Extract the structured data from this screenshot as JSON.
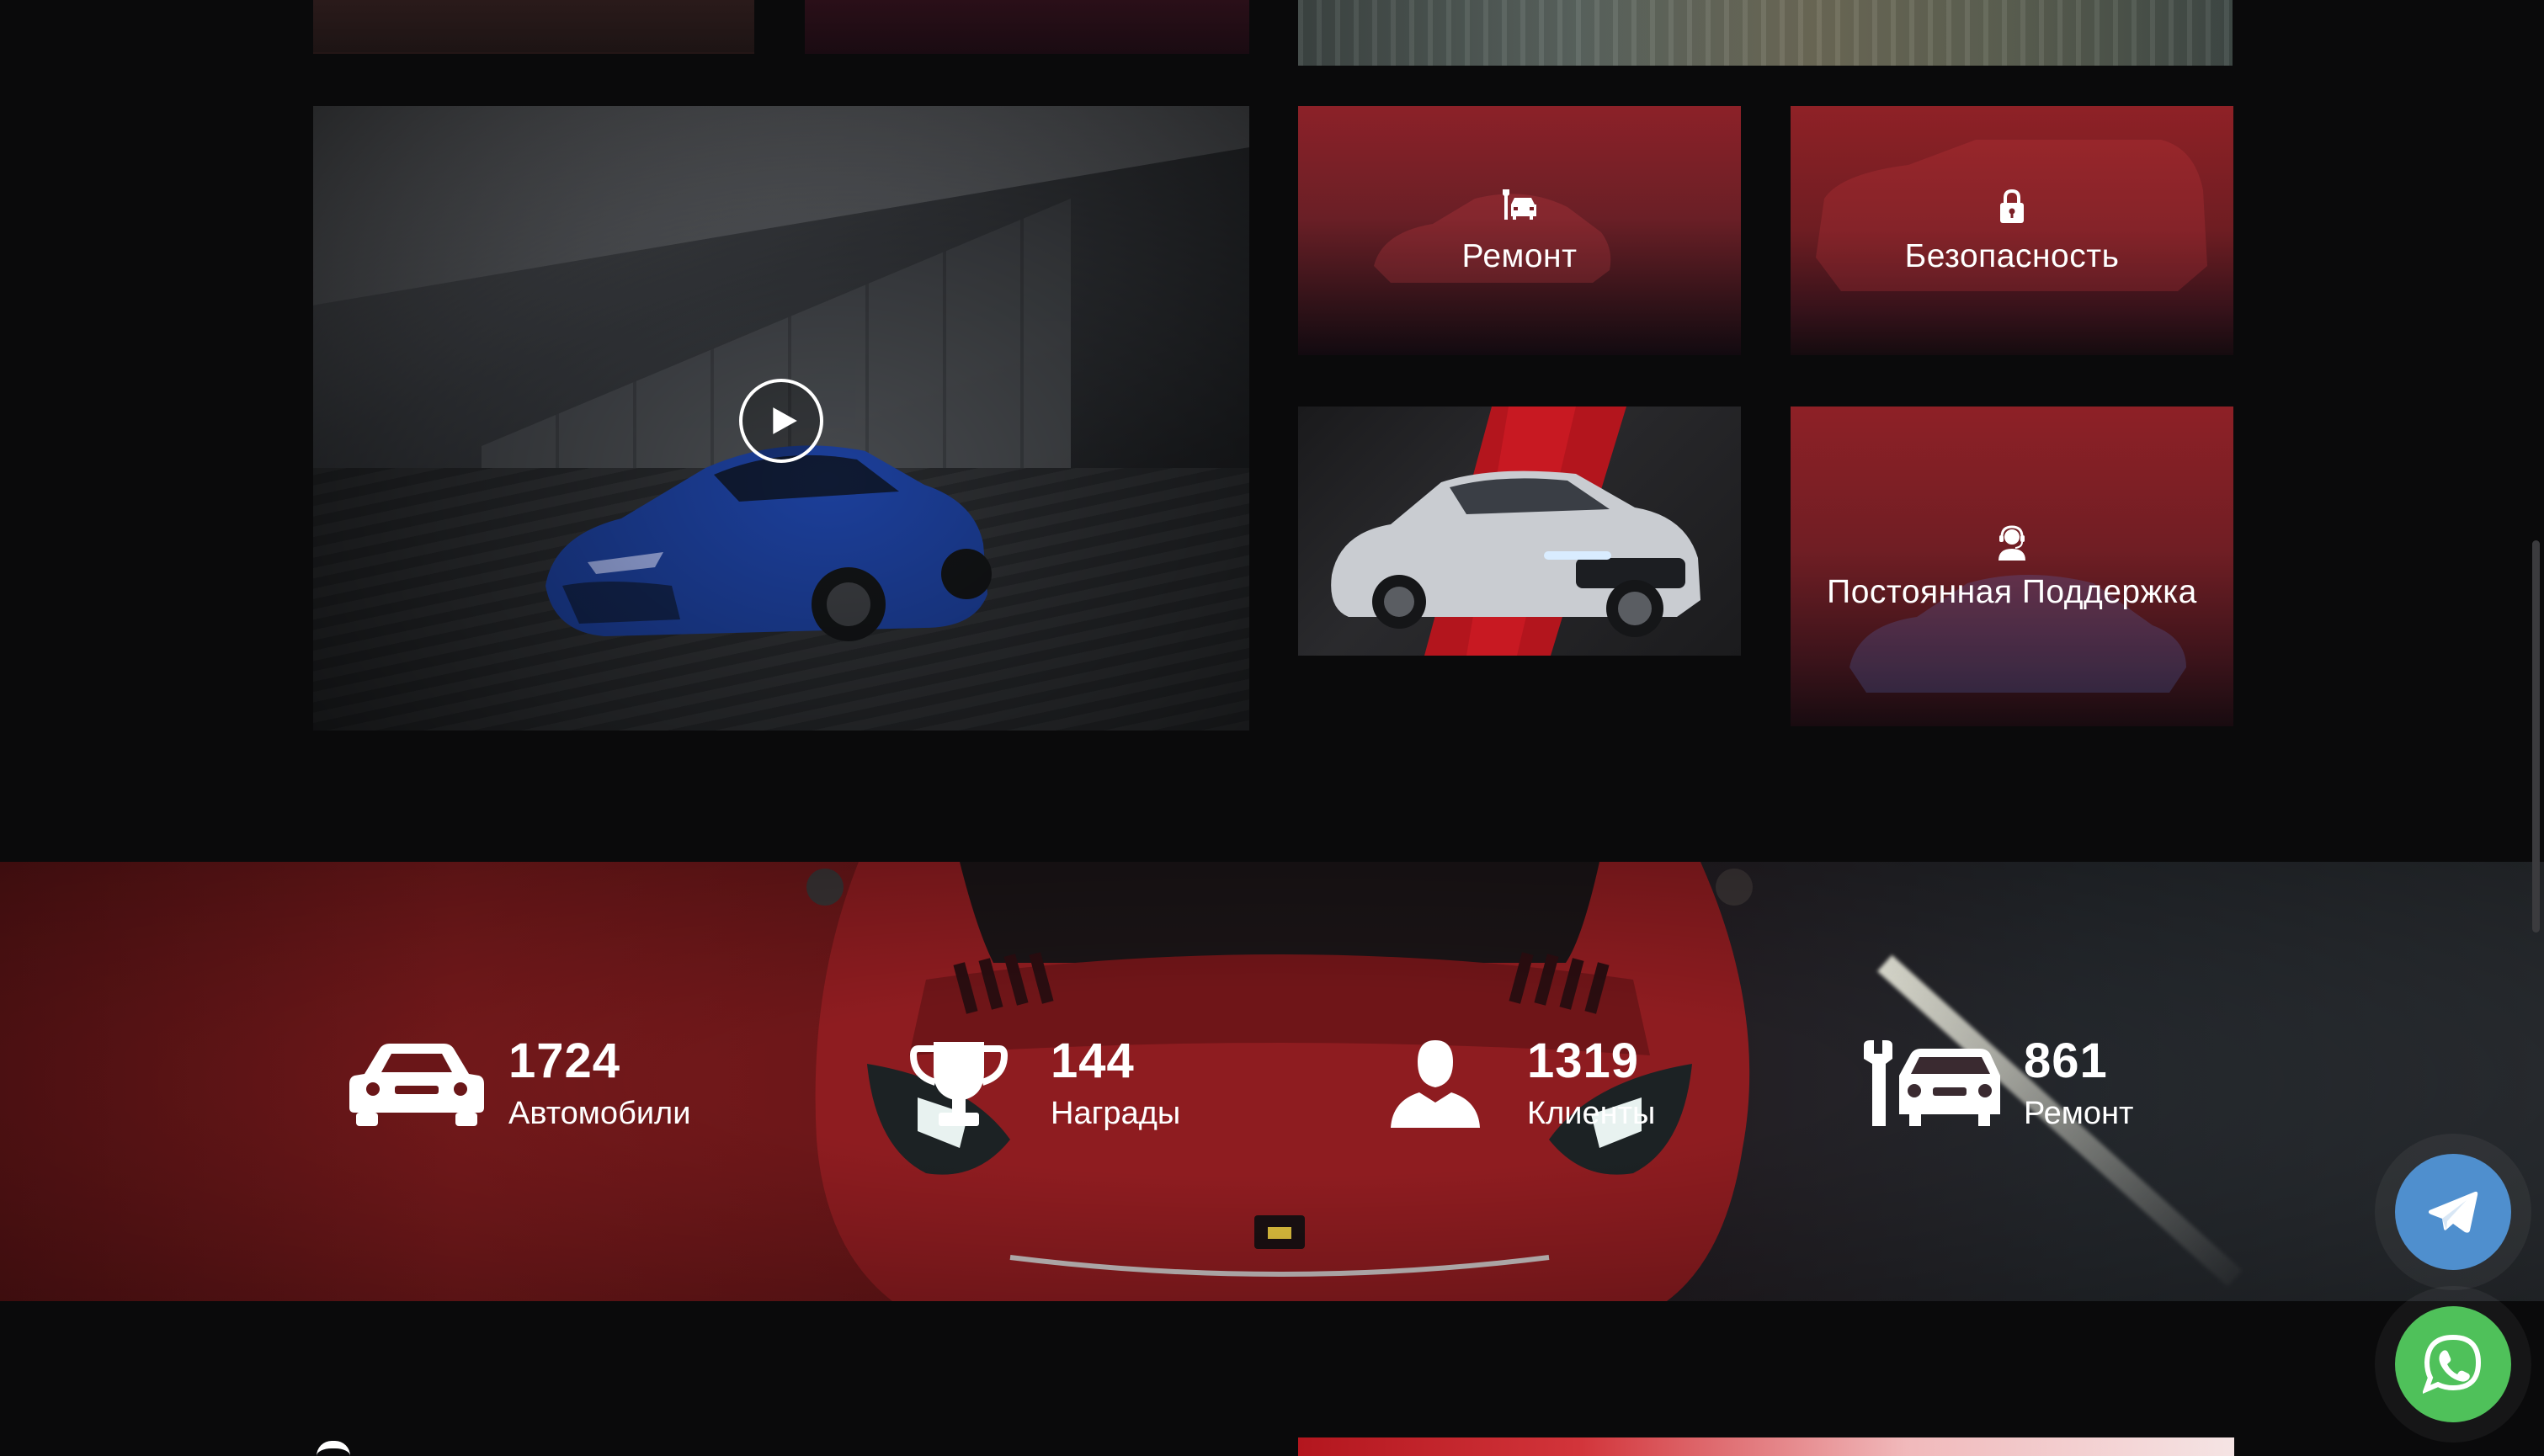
{
  "video": {
    "play_icon": "play-icon"
  },
  "features": {
    "repair": {
      "label": "Ремонт",
      "icon": "car-wrench-icon"
    },
    "security": {
      "label": "Безопасность",
      "icon": "lock-icon"
    },
    "support": {
      "label": "Постоянная Поддержка",
      "icon": "support-agent-icon"
    }
  },
  "stats": [
    {
      "value": "1724",
      "label": "Автомобили",
      "icon": "car-icon"
    },
    {
      "value": "144",
      "label": "Награды",
      "icon": "trophy-icon"
    },
    {
      "value": "1319",
      "label": "Клиенты",
      "icon": "user-icon"
    },
    {
      "value": "861",
      "label": "Ремонт",
      "icon": "car-repair-icon"
    }
  ],
  "floating": {
    "telegram": "telegram-icon",
    "whatsapp": "whatsapp-icon"
  },
  "colors": {
    "background": "#0a0a0b",
    "accent_red": "#8c2128",
    "telegram": "#4f8fce",
    "whatsapp": "#4fc15a"
  }
}
